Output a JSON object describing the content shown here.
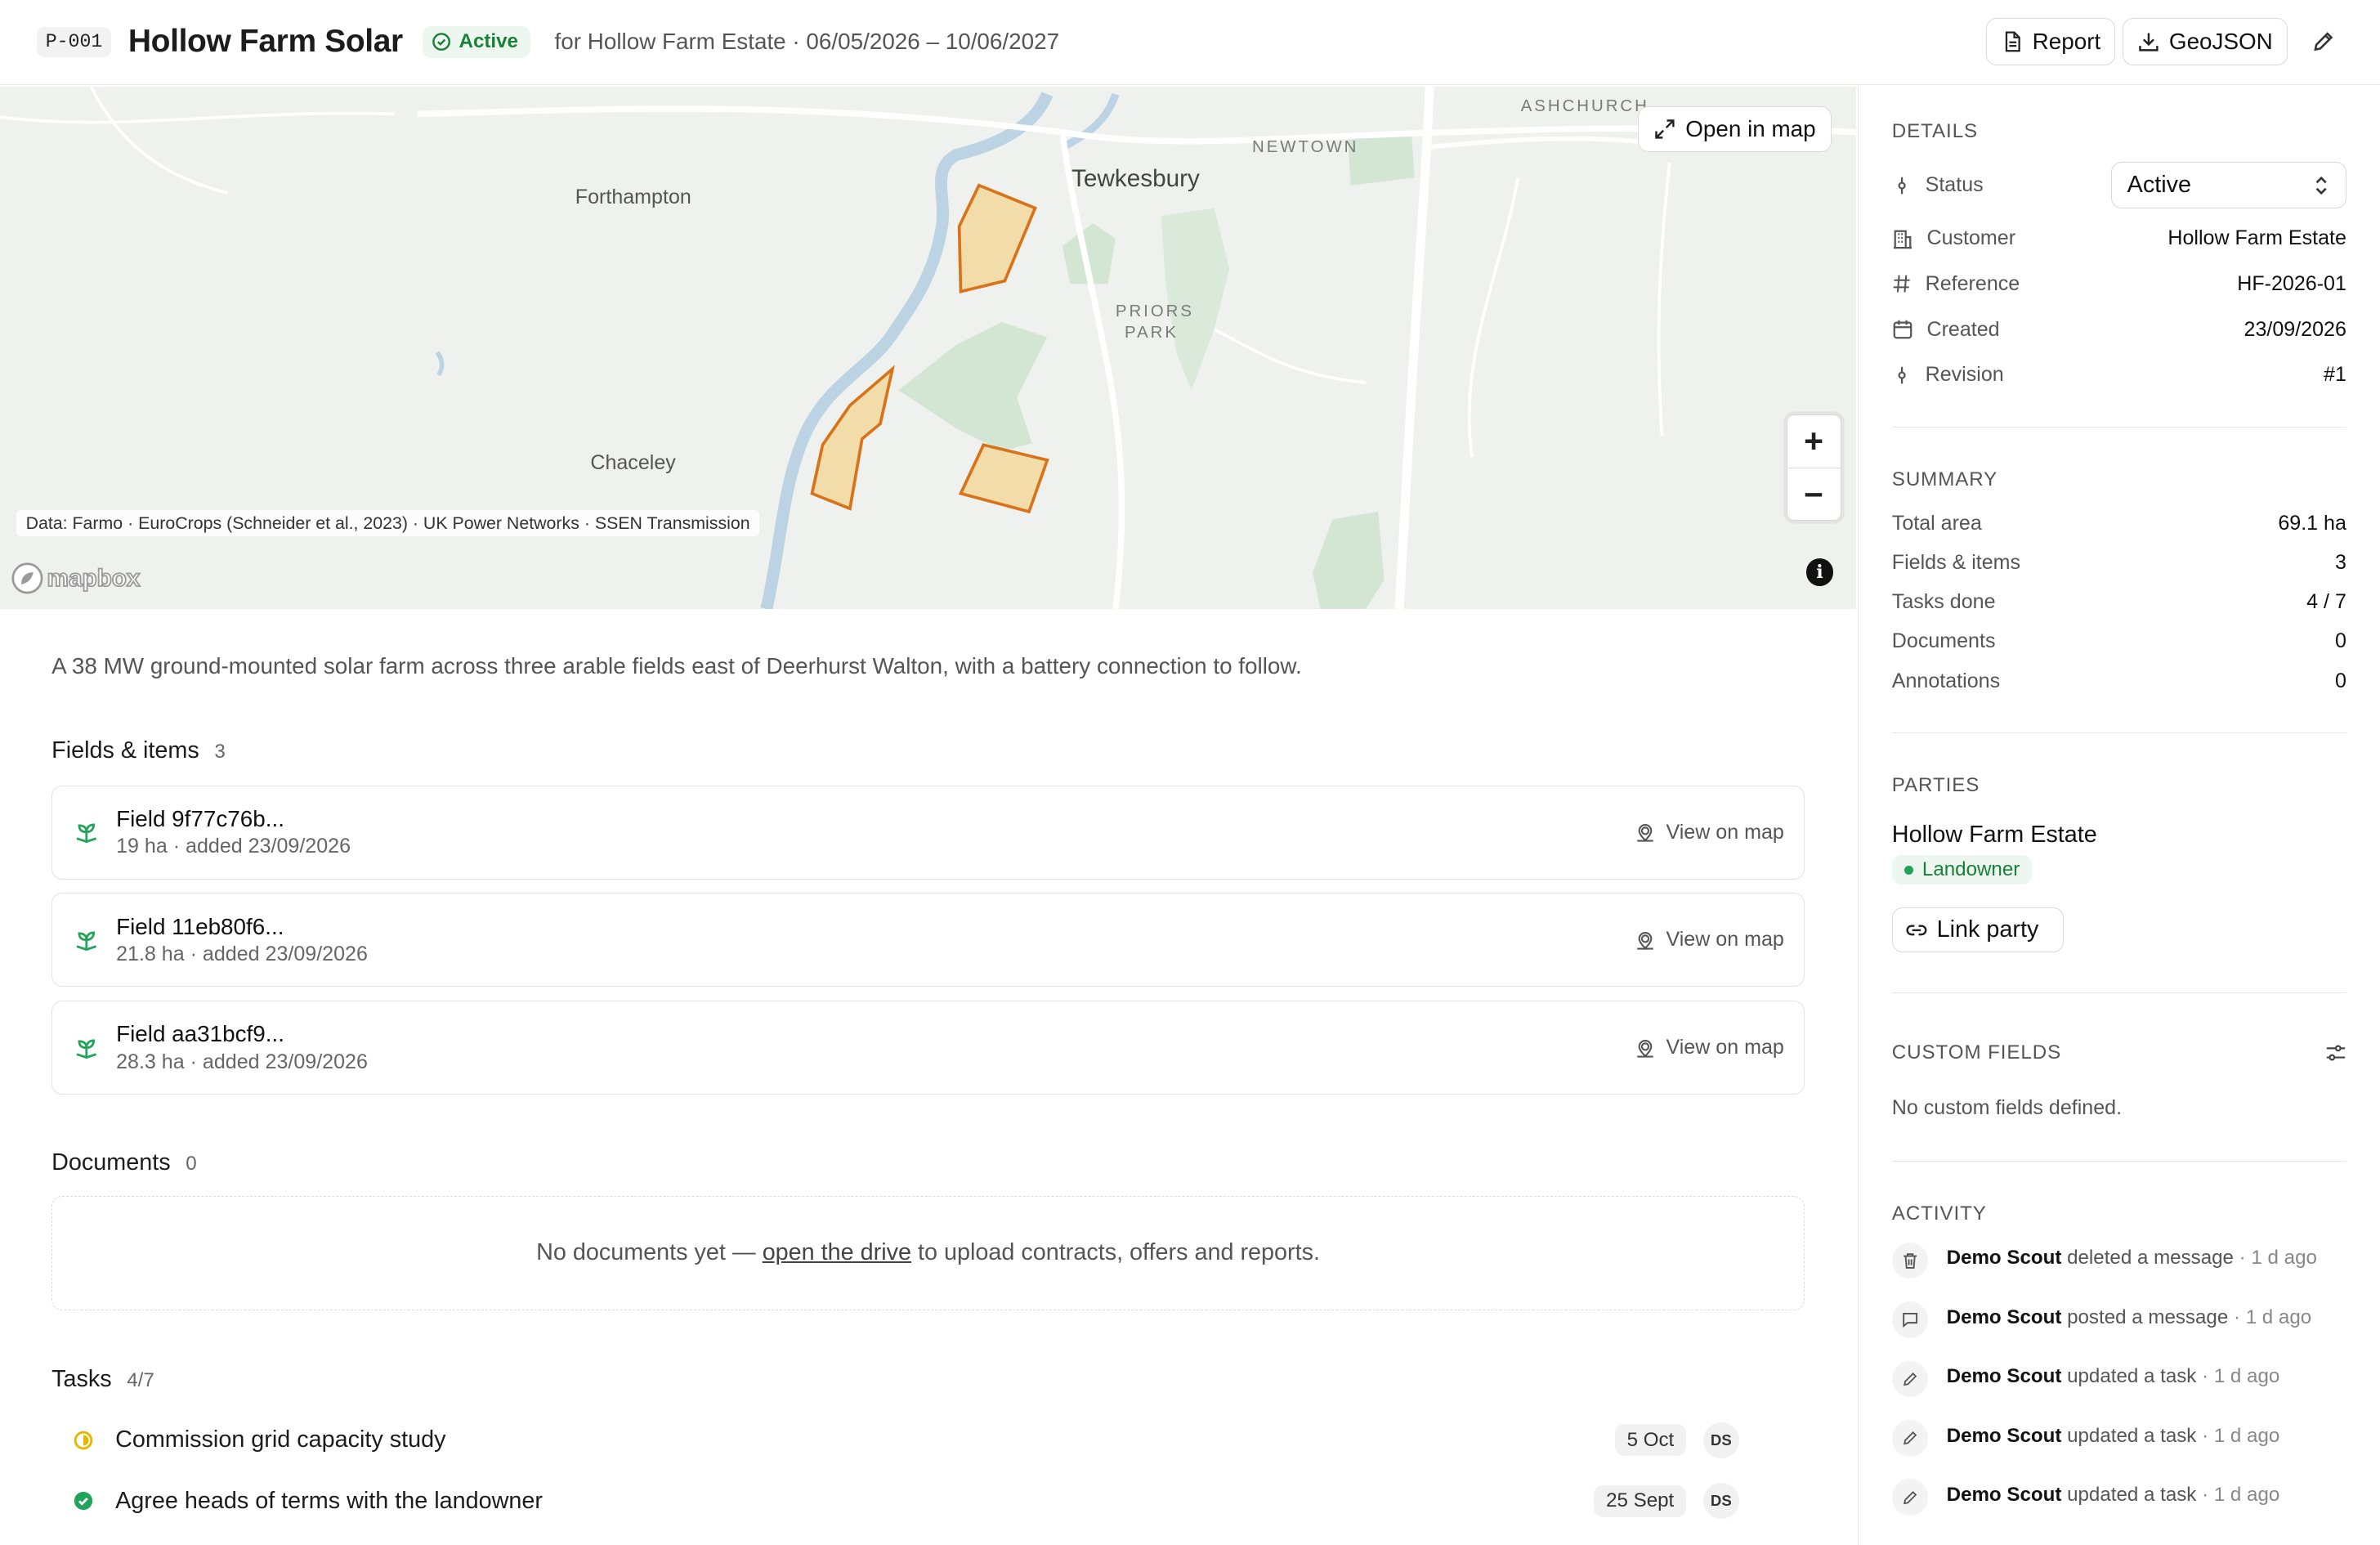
{
  "header": {
    "project_id": "P-001",
    "title": "Hollow Farm Solar",
    "status": "Active",
    "subtitle": "for Hollow Farm Estate · 06/05/2026 – 10/06/2027",
    "report_label": "Report",
    "geojson_label": "GeoJSON"
  },
  "map": {
    "place_labels": [
      "Forthampton",
      "Tewkesbury",
      "Chaceley"
    ],
    "area_labels": [
      "ASHCHURCH",
      "NEWTOWN",
      "PRIORS",
      "PARK"
    ],
    "open_label": "Open in map",
    "attribution": "Data: Farmo · EuroCrops (Schneider et al., 2023) · UK Power Networks · SSEN Transmission",
    "logo": "mapbox",
    "field_fill": "#f2dcaa",
    "field_stroke": "#d9731a"
  },
  "description": "A 38 MW ground-mounted solar farm across three arable fields east of Deerhurst Walton, with a battery connection to follow.",
  "fields": {
    "title": "Fields & items",
    "count": "3",
    "view_label": "View on map",
    "items": [
      {
        "name": "Field 9f77c76b...",
        "meta": "19 ha · added 23/09/2026"
      },
      {
        "name": "Field 11eb80f6...",
        "meta": "21.8 ha · added 23/09/2026"
      },
      {
        "name": "Field aa31bcf9...",
        "meta": "28.3 ha · added 23/09/2026"
      }
    ]
  },
  "documents": {
    "title": "Documents",
    "count": "0",
    "empty_before": "No documents yet — ",
    "empty_link": "open the drive",
    "empty_after": " to upload contracts, offers and reports."
  },
  "tasks": {
    "title": "Tasks",
    "count": "4/7",
    "items": [
      {
        "name": "Commission grid capacity study",
        "date": "5 Oct",
        "assignee": "DS",
        "state": "in-progress"
      },
      {
        "name": "Agree heads of terms with the landowner",
        "date": "25 Sept",
        "assignee": "DS",
        "state": "done"
      }
    ]
  },
  "details": {
    "title": "DETAILS",
    "status_label": "Status",
    "status_value": "Active",
    "customer_label": "Customer",
    "customer_value": "Hollow Farm Estate",
    "reference_label": "Reference",
    "reference_value": "HF-2026-01",
    "created_label": "Created",
    "created_value": "23/09/2026",
    "revision_label": "Revision",
    "revision_value": "#1"
  },
  "summary": {
    "title": "SUMMARY",
    "rows": [
      {
        "label": "Total area",
        "value": "69.1 ha"
      },
      {
        "label": "Fields & items",
        "value": "3"
      },
      {
        "label": "Tasks done",
        "value": "4 / 7"
      },
      {
        "label": "Documents",
        "value": "0"
      },
      {
        "label": "Annotations",
        "value": "0"
      }
    ]
  },
  "parties": {
    "title": "PARTIES",
    "name": "Hollow Farm Estate",
    "role": "Landowner",
    "link_label": "Link party"
  },
  "custom_fields": {
    "title": "CUSTOM FIELDS",
    "empty": "No custom fields defined."
  },
  "activity": {
    "title": "ACTIVITY",
    "items": [
      {
        "user": "Demo Scout",
        "action": "deleted a message",
        "ago": "· 1 d ago",
        "icon": "trash-icon"
      },
      {
        "user": "Demo Scout",
        "action": "posted a message",
        "ago": "· 1 d ago",
        "icon": "message-icon"
      },
      {
        "user": "Demo Scout",
        "action": "updated a task",
        "ago": "· 1 d ago",
        "icon": "pencil-icon"
      },
      {
        "user": "Demo Scout",
        "action": "updated a task",
        "ago": "· 1 d ago",
        "icon": "pencil-icon"
      },
      {
        "user": "Demo Scout",
        "action": "updated a task",
        "ago": "· 1 d ago",
        "icon": "pencil-icon"
      }
    ]
  },
  "colors": {
    "accent_green": "#198038",
    "status_bg": "#edf7ef",
    "task_in_progress": "#e6b800",
    "task_done": "#22a35a",
    "field_icon": "#22a35a"
  }
}
